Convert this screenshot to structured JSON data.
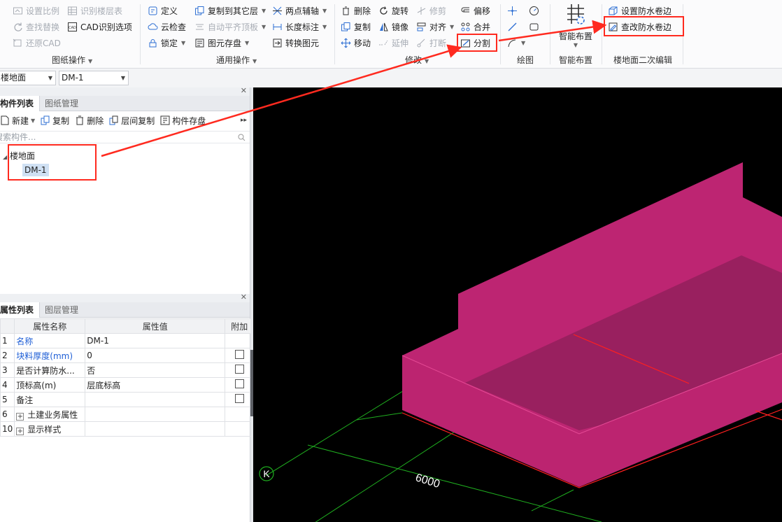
{
  "ribbon": {
    "groups": {
      "drawing_ops": {
        "label": "图纸操作",
        "buttons": {
          "set_scale": "设置比例",
          "identify_floors": "识别楼层表",
          "find_replace": "查找替换",
          "cad_options": "CAD识别选项",
          "restore_cad": "还原CAD"
        }
      },
      "general_ops": {
        "label": "通用操作",
        "buttons": {
          "define": "定义",
          "copy_to_floor": "复制到其它层",
          "two_point_axis": "两点辅轴",
          "cloud_check": "云检查",
          "auto_align_slab": "自动平齐顶板",
          "length_dim": "长度标注",
          "lock": "锁定",
          "save_element": "图元存盘",
          "convert_element": "转换图元"
        }
      },
      "modify": {
        "label": "修改",
        "buttons": {
          "delete": "删除",
          "rotate": "旋转",
          "trim": "修剪",
          "offset": "偏移",
          "copy": "复制",
          "mirror": "镜像",
          "align": "对齐",
          "merge": "合并",
          "move": "移动",
          "extend": "延伸",
          "break": "打断",
          "split": "分割"
        }
      },
      "draw": {
        "label": "绘图"
      },
      "smart_layout": {
        "label": "智能布置",
        "button": "智能布置"
      },
      "floor_edit": {
        "label": "楼地面二次编辑",
        "buttons": {
          "set_waterproof": "设置防水卷边",
          "edit_waterproof": "查改防水卷边"
        }
      }
    }
  },
  "selectors": {
    "type": "楼地面",
    "element": "DM-1"
  },
  "component_panel": {
    "tabs": [
      "构件列表",
      "图纸管理"
    ],
    "toolbar": {
      "new": "新建",
      "copy": "复制",
      "delete": "删除",
      "floor_copy": "层间复制",
      "save": "构件存盘"
    },
    "search_placeholder": "搜索构件...",
    "tree": {
      "root": "楼地面",
      "child": "DM-1"
    }
  },
  "property_panel": {
    "tabs": [
      "属性列表",
      "图层管理"
    ],
    "headers": [
      "属性名称",
      "属性值",
      "附加"
    ],
    "rows": [
      {
        "num": "1",
        "name": "名称",
        "value": "DM-1",
        "blue": true,
        "check": false
      },
      {
        "num": "2",
        "name": "块料厚度(mm)",
        "value": "0",
        "blue": true,
        "check": true
      },
      {
        "num": "3",
        "name": "是否计算防水...",
        "value": "否",
        "blue": false,
        "check": true
      },
      {
        "num": "4",
        "name": "顶标高(m)",
        "value": "层底标高",
        "blue": false,
        "check": true
      },
      {
        "num": "5",
        "name": "备注",
        "value": "",
        "blue": false,
        "check": true
      },
      {
        "num": "6",
        "name": "土建业务属性",
        "value": "",
        "blue": false,
        "check": false,
        "expand": true
      },
      {
        "num": "10",
        "name": "显示样式",
        "value": "",
        "blue": false,
        "check": false,
        "expand": true
      }
    ]
  },
  "viewport": {
    "axis_label": "K",
    "dimension": "6000",
    "colors": {
      "slab_top": "#bd2572",
      "slab_side": "#bc2470",
      "slab_inner": "#99205f",
      "grid": "#1fae1f",
      "axis": "#ff1f1f"
    }
  },
  "annotations": {
    "highlight_color": "#ff2a1f"
  }
}
